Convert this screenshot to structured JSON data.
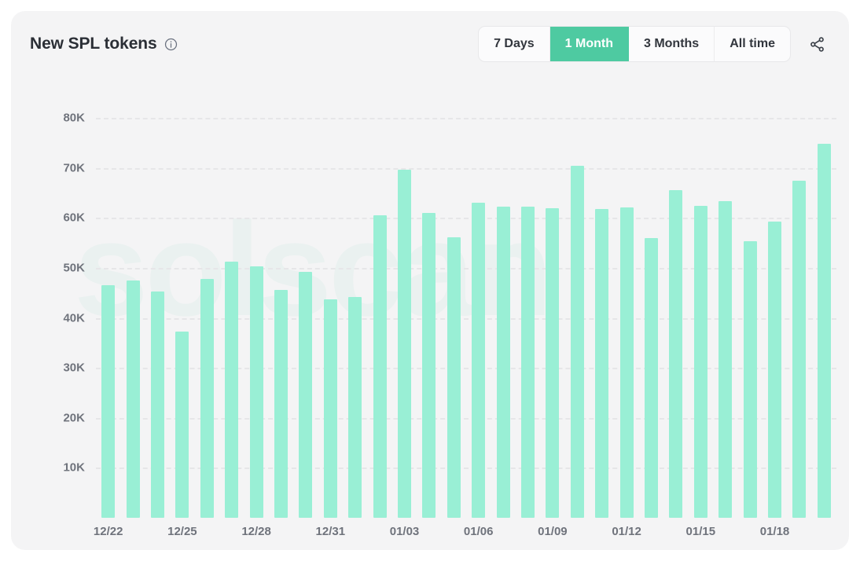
{
  "card": {
    "background_color": "#f4f4f5",
    "watermark_text": "solscan"
  },
  "header": {
    "title": "New SPL tokens",
    "info_icon": "info-circle-icon",
    "share_icon": "share-icon"
  },
  "range_selector": {
    "options": [
      {
        "label": "7 Days",
        "active": false
      },
      {
        "label": "1 Month",
        "active": true
      },
      {
        "label": "3 Months",
        "active": false
      },
      {
        "label": "All time",
        "active": false
      }
    ],
    "active_color": "#4ecaa1",
    "active_label": "1 Month"
  },
  "chart_data": {
    "type": "bar",
    "title": "New SPL tokens",
    "xlabel": "",
    "ylabel": "",
    "bar_color": "#99efd5",
    "grid": true,
    "legend": "none",
    "ylim": [
      0,
      82000
    ],
    "ytick_values": [
      10000,
      20000,
      30000,
      40000,
      50000,
      60000,
      70000,
      80000
    ],
    "ytick_labels": [
      "10K",
      "20K",
      "30K",
      "40K",
      "50K",
      "60K",
      "70K",
      "80K"
    ],
    "xtick_labels": [
      "12/22",
      "12/25",
      "12/28",
      "12/31",
      "01/03",
      "01/06",
      "01/09",
      "01/12",
      "01/15",
      "01/18"
    ],
    "xtick_indices": [
      0,
      3,
      6,
      9,
      12,
      15,
      18,
      21,
      24,
      27
    ],
    "categories": [
      "12/22",
      "12/23",
      "12/24",
      "12/25",
      "12/26",
      "12/27",
      "12/28",
      "12/29",
      "12/30",
      "12/31",
      "01/01",
      "01/02",
      "01/03",
      "01/04",
      "01/05",
      "01/06",
      "01/07",
      "01/08",
      "01/09",
      "01/10",
      "01/11",
      "01/12",
      "01/13",
      "01/14",
      "01/15",
      "01/16",
      "01/17",
      "01/18",
      "01/19",
      "01/20"
    ],
    "values": [
      46500,
      47500,
      45300,
      37300,
      47800,
      51300,
      50300,
      45600,
      49200,
      43700,
      44200,
      60500,
      69600,
      61000,
      56200,
      63000,
      62300,
      62200,
      61900,
      70500,
      61800,
      62100,
      56000,
      65500,
      62500,
      63400,
      55400,
      59300,
      67400,
      74800
    ]
  }
}
